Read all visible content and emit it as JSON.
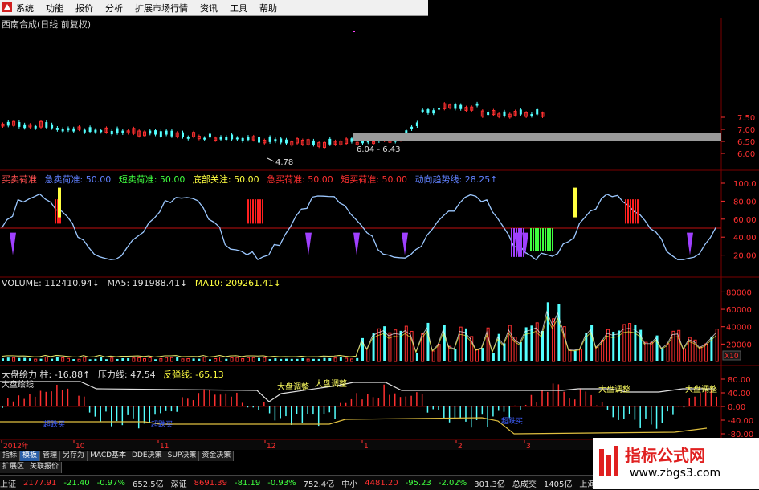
{
  "menu": {
    "items": [
      "系统",
      "功能",
      "报价",
      "分析",
      "扩展市场行情",
      "资讯",
      "工具",
      "帮助"
    ]
  },
  "title": "西南合成(日线 前复权)",
  "price_panel": {
    "axis": [
      "7.50",
      "7.00",
      "6.50",
      "6.00"
    ],
    "low_label": "4.78",
    "range_label": "6.04 - 6.43",
    "colors": {
      "up": "#ff3030",
      "down": "#54ffff"
    }
  },
  "osc_panel": {
    "legend": [
      {
        "text": "买卖荷准",
        "color": "#ff5050"
      },
      {
        "text": "急卖荷准: 50.00",
        "color": "#6080ff"
      },
      {
        "text": "短卖荷准: 50.00",
        "color": "#40ff40"
      },
      {
        "text": "底部关注: 50.00",
        "color": "#ffff40"
      },
      {
        "text": "急买荷准: 50.00",
        "color": "#ff3030"
      },
      {
        "text": "短买荷准: 50.00",
        "color": "#ff3030"
      },
      {
        "text": "动向趋势线: 28.25↑",
        "color": "#6080ff"
      }
    ],
    "axis": [
      "100.0",
      "80.00",
      "60.00",
      "40.00",
      "20.00"
    ]
  },
  "vol_panel": {
    "legend": [
      {
        "text": "VOLUME: 112410.94↓",
        "color": "#e0e0e0"
      },
      {
        "text": "MA5: 191988.41↓",
        "color": "#e0e0e0"
      },
      {
        "text": "MA10: 209261.41↓",
        "color": "#ffff40"
      }
    ],
    "axis": [
      "80000",
      "60000",
      "40000",
      "20000"
    ],
    "unit": "X10"
  },
  "force_panel": {
    "legend": [
      {
        "text": "大盘绘力 柱: -16.88↑",
        "color": "#e0e0e0"
      },
      {
        "text": "压力线: 47.54",
        "color": "#e0e0e0"
      },
      {
        "text": "反弹线: -65.13",
        "color": "#ffff40"
      }
    ],
    "axis": [
      "80.00",
      "40.00",
      "0.00",
      "-40.00",
      "-80.00"
    ],
    "annotations": [
      "大盘调整",
      "大盘调整",
      "大盘调整",
      "大盘调整"
    ],
    "blue_annotations": [
      "超跌买",
      "超跌买",
      "超跌买"
    ],
    "top_left": "大盘绘线"
  },
  "time_axis": [
    "2012年",
    "10",
    "11",
    "12",
    "1",
    "2",
    "3"
  ],
  "tabs": [
    "指标",
    "模板",
    "管理",
    "另存为",
    "MACD基本",
    "DDE决策",
    "SUP决策",
    "资金决策"
  ],
  "active_tab": 1,
  "row2": [
    "扩展区",
    "关联报价"
  ],
  "status": [
    {
      "text": "上证",
      "color": "#e0e0e0"
    },
    {
      "text": "2177.91",
      "color": "#ff3030"
    },
    {
      "text": "-21.40",
      "color": "#40ff40"
    },
    {
      "text": "-0.97%",
      "color": "#40ff40"
    },
    {
      "text": "652.5亿",
      "color": "#e0e0e0"
    },
    {
      "text": "深证",
      "color": "#e0e0e0"
    },
    {
      "text": "8691.39",
      "color": "#ff3030"
    },
    {
      "text": "-81.19",
      "color": "#40ff40"
    },
    {
      "text": "-0.93%",
      "color": "#40ff40"
    },
    {
      "text": "752.4亿",
      "color": "#e0e0e0"
    },
    {
      "text": "中小",
      "color": "#e0e0e0"
    },
    {
      "text": "4481.20",
      "color": "#ff3030"
    },
    {
      "text": "-95.23",
      "color": "#40ff40"
    },
    {
      "text": "-2.02%",
      "color": "#40ff40"
    },
    {
      "text": "301.3亿",
      "color": "#e0e0e0"
    },
    {
      "text": "总成交",
      "color": "#e0e0e0"
    },
    {
      "text": "1405亿",
      "color": "#e0e0e0"
    },
    {
      "text": "上海行情主站",
      "color": "#e0e0e0"
    }
  ],
  "watermark": {
    "name": "指标公式网",
    "url": "www.zbgs3.com"
  }
}
